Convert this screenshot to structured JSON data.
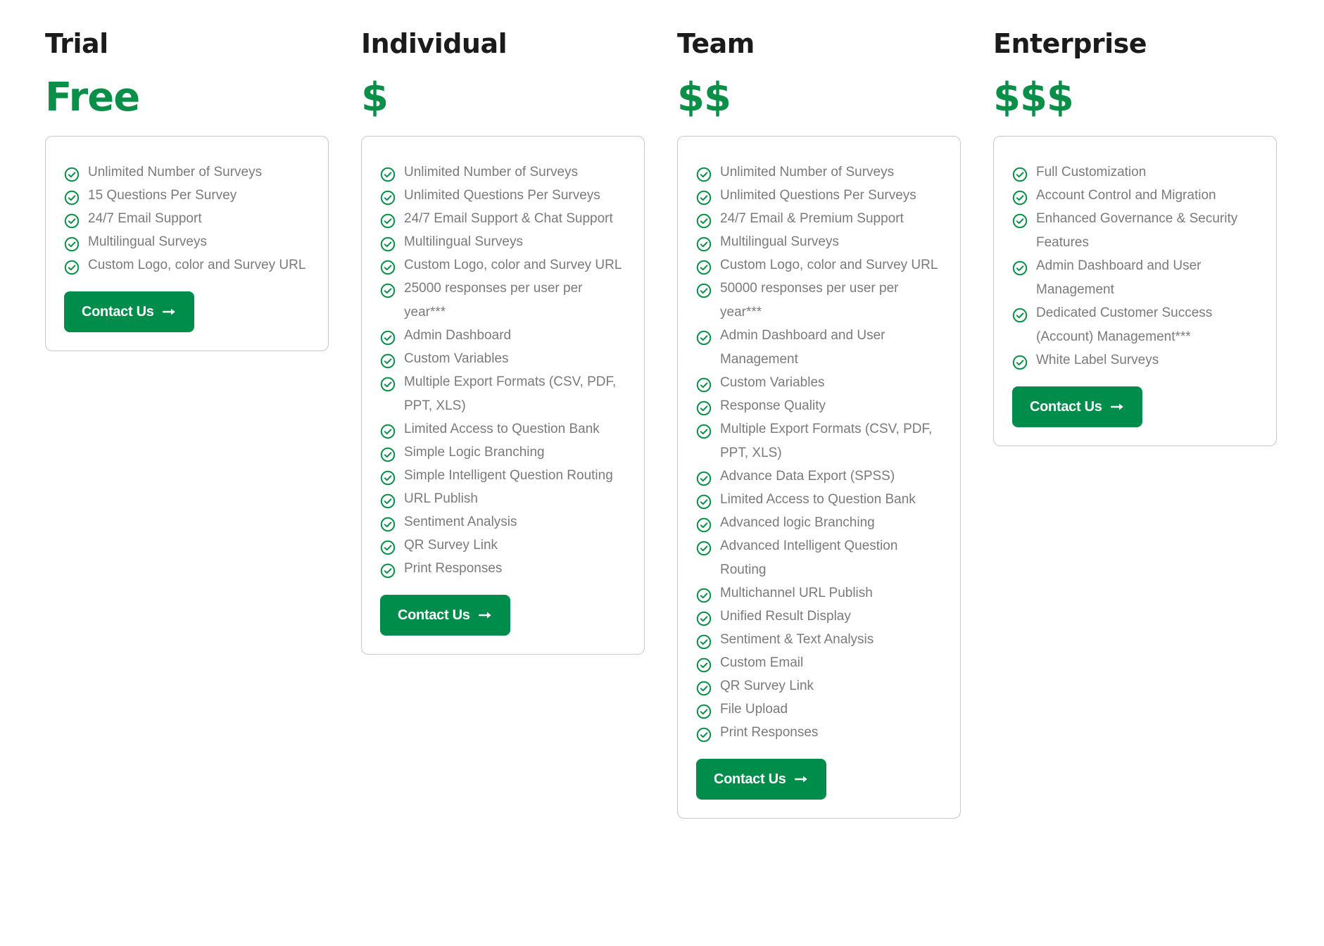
{
  "colors": {
    "accent": "#008c4a",
    "price": "#0a8f48",
    "heading": "#1b1b1b",
    "feature_text": "#7a7a7a",
    "card_border": "#c9c9c9"
  },
  "plans": [
    {
      "name": "Trial",
      "price": "Free",
      "features": [
        "Unlimited Number of Surveys",
        "15 Questions Per Survey",
        "24/7 Email Support",
        "Multilingual Surveys",
        "Custom Logo, color and Survey URL"
      ],
      "button_label": "Contact Us",
      "button_icon": "arrow-right-icon"
    },
    {
      "name": "Individual",
      "price": "$",
      "features": [
        "Unlimited Number of Surveys",
        "Unlimited Questions Per Surveys",
        "24/7 Email Support & Chat Support",
        "Multilingual Surveys",
        "Custom Logo, color and Survey URL",
        "25000 responses per user per year***",
        "Admin Dashboard",
        "Custom Variables",
        "Multiple Export Formats (CSV, PDF, PPT, XLS)",
        "Limited Access to Question Bank",
        "Simple Logic Branching",
        "Simple Intelligent Question Routing",
        "URL Publish",
        "Sentiment Analysis",
        "QR Survey Link",
        "Print Responses"
      ],
      "button_label": "Contact Us",
      "button_icon": "arrow-right-icon"
    },
    {
      "name": "Team",
      "price": "$$",
      "features": [
        "Unlimited Number of Surveys",
        "Unlimited Questions Per Surveys",
        "24/7 Email & Premium Support",
        "Multilingual Surveys",
        "Custom Logo, color and Survey URL",
        "50000 responses per user per year***",
        "Admin Dashboard and User Management",
        "Custom Variables",
        "Response Quality",
        "Multiple Export Formats (CSV, PDF, PPT, XLS)",
        "Advance Data Export (SPSS)",
        "Limited Access to Question Bank",
        "Advanced logic Branching",
        "Advanced Intelligent Question Routing",
        "Multichannel URL Publish",
        "Unified Result Display",
        "Sentiment & Text Analysis",
        "Custom Email",
        "QR Survey Link",
        "File Upload",
        "Print Responses"
      ],
      "button_label": "Contact Us",
      "button_icon": "arrow-right-icon"
    },
    {
      "name": "Enterprise",
      "price": "$$$",
      "features": [
        "Full Customization",
        "Account Control and Migration",
        "Enhanced Governance & Security Features",
        "Admin Dashboard and User Management",
        "Dedicated Customer Success (Account) Management***",
        "White Label Surveys"
      ],
      "button_label": "Contact Us",
      "button_icon": "arrow-right-icon"
    }
  ]
}
